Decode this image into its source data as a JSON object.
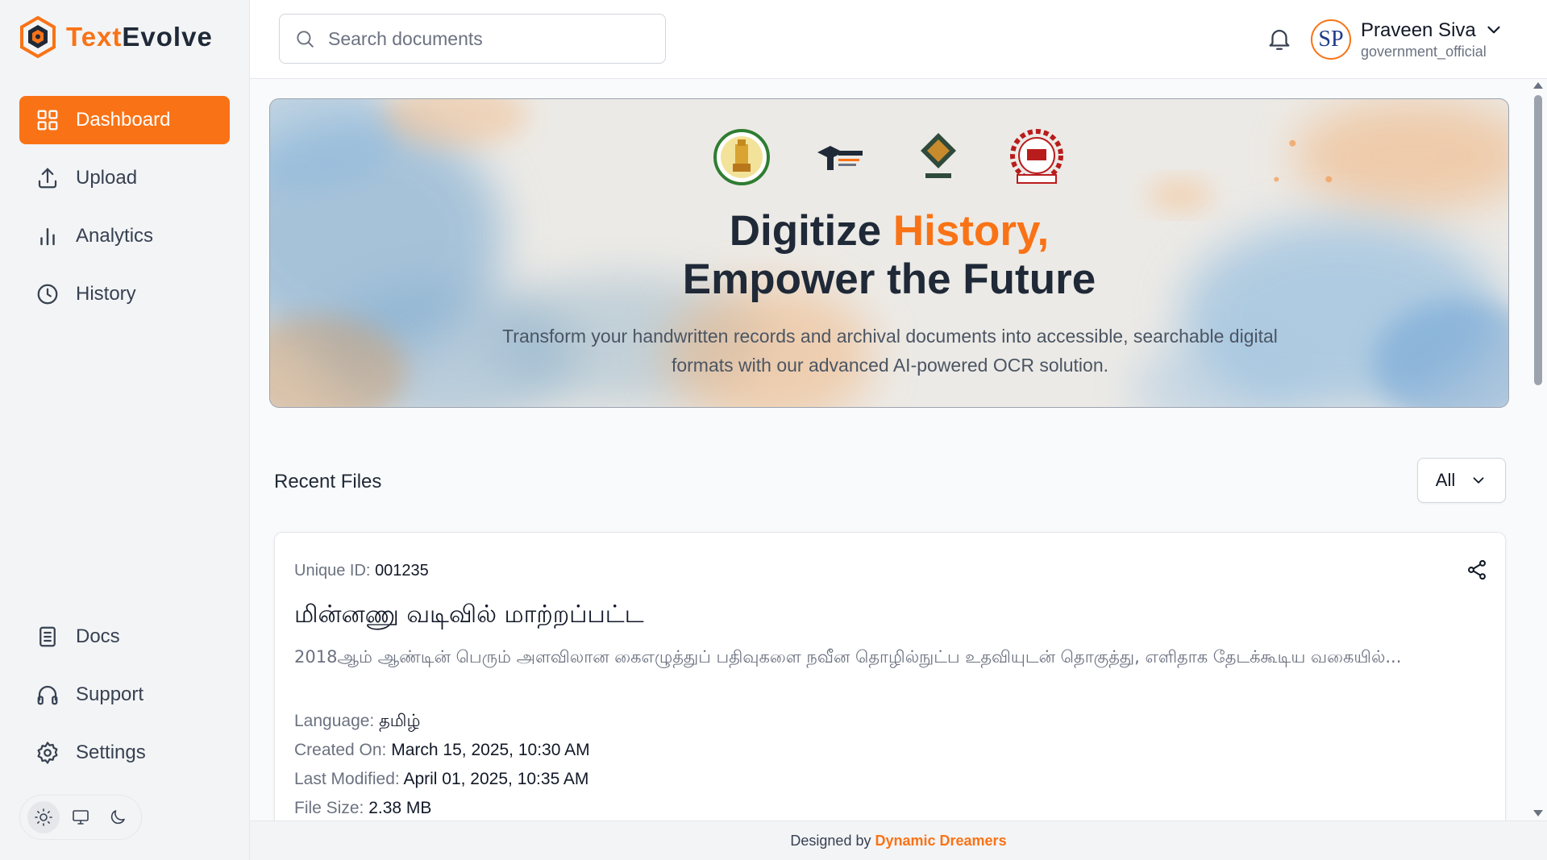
{
  "app": {
    "name_part1": "Text",
    "name_part2": "Evolve",
    "accent_color": "#f97316"
  },
  "sidebar": {
    "items": [
      {
        "label": "Dashboard",
        "icon": "grid-icon",
        "active": true
      },
      {
        "label": "Upload",
        "icon": "upload-icon",
        "active": false
      },
      {
        "label": "Analytics",
        "icon": "bar-chart-icon",
        "active": false
      },
      {
        "label": "History",
        "icon": "clock-icon",
        "active": false
      }
    ],
    "bottom_items": [
      {
        "label": "Docs",
        "icon": "document-icon"
      },
      {
        "label": "Support",
        "icon": "headphones-icon"
      },
      {
        "label": "Settings",
        "icon": "gear-icon"
      }
    ],
    "theme_options": [
      "light",
      "system",
      "dark"
    ],
    "theme_selected": "light"
  },
  "header": {
    "search_placeholder": "Search documents",
    "user_initials": "SP",
    "user_name": "Praveen Siva",
    "user_role": "government_official"
  },
  "hero": {
    "title_part1": "Digitize ",
    "title_highlight": "History,",
    "title_line2": "Empower the Future",
    "subtitle": "Transform your handwritten records and archival documents into accessible, searchable digital formats with our advanced AI-powered OCR solution."
  },
  "recent": {
    "label": "Recent Files",
    "filter_value": "All"
  },
  "file": {
    "uid_label": "Unique ID:",
    "uid_value": "001235",
    "title": "மின்னணு வடிவில் மாற்றப்பட்ட",
    "description": "2018ஆம் ஆண்டின் பெரும் அளவிலான கைஎழுத்துப் பதிவுகளை நவீன தொழில்நுட்ப உதவியுடன் தொகுத்து, எளிதாக தேடக்கூடிய வகையில்...",
    "language_label": "Language:",
    "language_value": "தமிழ்",
    "created_label": "Created On:",
    "created_value": "March 15, 2025, 10:30 AM",
    "modified_label": "Last Modified:",
    "modified_value": "April 01, 2025, 10:35 AM",
    "size_label": "File Size:",
    "size_value": "2.38 MB"
  },
  "footer": {
    "prefix": "Designed by",
    "brand": "Dynamic Dreamers"
  }
}
